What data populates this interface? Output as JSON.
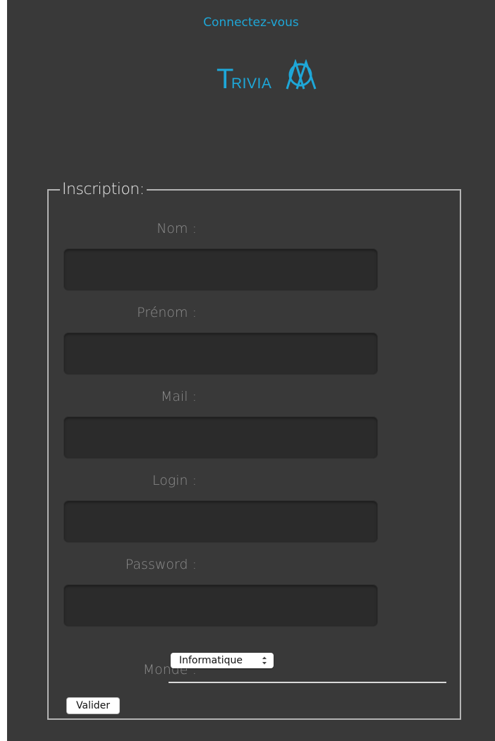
{
  "header": {
    "login_link": "Connectez-vous",
    "logo_text": "TRIVIA",
    "logo_letter_t": "T",
    "logo_letters_rest": "RIVIA"
  },
  "form": {
    "legend": "Inscription:",
    "fields": [
      {
        "label": "Nom :",
        "value": ""
      },
      {
        "label": "Prénom :",
        "value": ""
      },
      {
        "label": "Mail :",
        "value": ""
      },
      {
        "label": "Login :",
        "value": ""
      },
      {
        "label": "Password :",
        "value": ""
      }
    ],
    "monde_label": "Monde :",
    "monde_selected": "Informatique",
    "submit_label": "Valider"
  },
  "colors": {
    "background": "#393939",
    "accent": "#1ea7d8",
    "label": "#8e8e8e",
    "input_bg": "#2b2b2b"
  }
}
